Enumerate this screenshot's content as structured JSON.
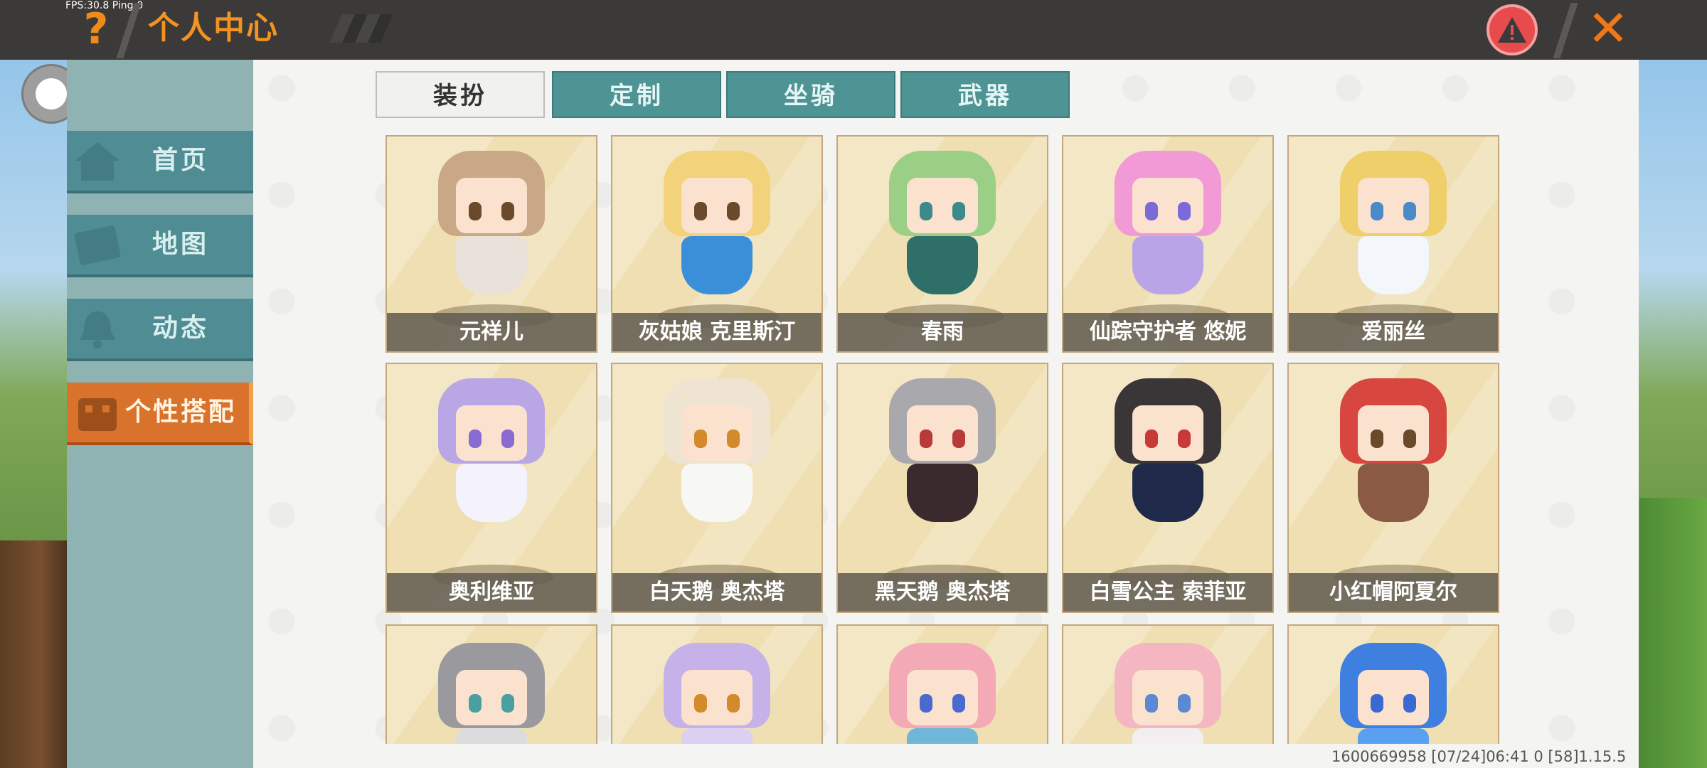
{
  "hud": {
    "fps_text": "FPS:30.8  Ping:0"
  },
  "header": {
    "title": "个人中心",
    "help_icon": "question-mark-icon",
    "warn_icon": "warning-icon",
    "close_icon": "close-icon"
  },
  "sidebar": {
    "items": [
      {
        "label": "首页",
        "icon": "home-icon",
        "active": false
      },
      {
        "label": "地图",
        "icon": "map-icon",
        "active": false
      },
      {
        "label": "动态",
        "icon": "bell-icon",
        "active": false
      },
      {
        "label": "个性搭配",
        "icon": "wardrobe-icon",
        "active": true
      }
    ]
  },
  "tabs": [
    {
      "label": "装扮",
      "active": true
    },
    {
      "label": "定制",
      "active": false
    },
    {
      "label": "坐骑",
      "active": false
    },
    {
      "label": "武器",
      "active": false
    }
  ],
  "skins": [
    {
      "name": "元祥儿",
      "hair": "#c9a887",
      "outfit": "#e8e2da",
      "eyes": "#6b4a2b"
    },
    {
      "name": "灰姑娘 克里斯汀",
      "hair": "#f2d27a",
      "outfit": "#3b8fd8",
      "eyes": "#6b4a2b"
    },
    {
      "name": "春雨",
      "hair": "#9ccf86",
      "outfit": "#2f6f6a",
      "eyes": "#3d8a8a"
    },
    {
      "name": "仙踪守护者 悠妮",
      "hair": "#f29ad6",
      "outfit": "#b9a4e8",
      "eyes": "#7a6bd8"
    },
    {
      "name": "爱丽丝",
      "hair": "#efcf6a",
      "outfit": "#f3f6fb",
      "eyes": "#4a8ac8"
    },
    {
      "name": "奥利维亚",
      "hair": "#b9a6e4",
      "outfit": "#f4f2fb",
      "eyes": "#8a6bd0"
    },
    {
      "name": "白天鹅 奥杰塔",
      "hair": "#efe4d2",
      "outfit": "#f7f7f4",
      "eyes": "#d28a2a"
    },
    {
      "name": "黑天鹅 奥杰塔",
      "hair": "#a9a9ad",
      "outfit": "#3a2a2e",
      "eyes": "#b83a3a"
    },
    {
      "name": "白雪公主 索菲亚",
      "hair": "#3a3536",
      "outfit": "#1f2a4a",
      "eyes": "#c83a3a"
    },
    {
      "name": "小红帽阿夏尔",
      "hair": "#d8473f",
      "outfit": "#8a5a44",
      "eyes": "#6b4a2b"
    },
    {
      "name": "",
      "hair": "#9a9a9e",
      "outfit": "#dcdcdc",
      "eyes": "#4aa0a0"
    },
    {
      "name": "",
      "hair": "#c6b2e8",
      "outfit": "#dcd0f2",
      "eyes": "#d28a2a"
    },
    {
      "name": "",
      "hair": "#f3a9b6",
      "outfit": "#6fb7d8",
      "eyes": "#4a6ad0"
    },
    {
      "name": "",
      "hair": "#f4b6c0",
      "outfit": "#f3eef0",
      "eyes": "#5a8ad0"
    },
    {
      "name": "",
      "hair": "#3f7fe0",
      "outfit": "#5aa0f0",
      "eyes": "#3a6ad0"
    }
  ],
  "footer": {
    "build_text": "1600669958    [07/24]06:41 0   [58]1.15.5"
  }
}
